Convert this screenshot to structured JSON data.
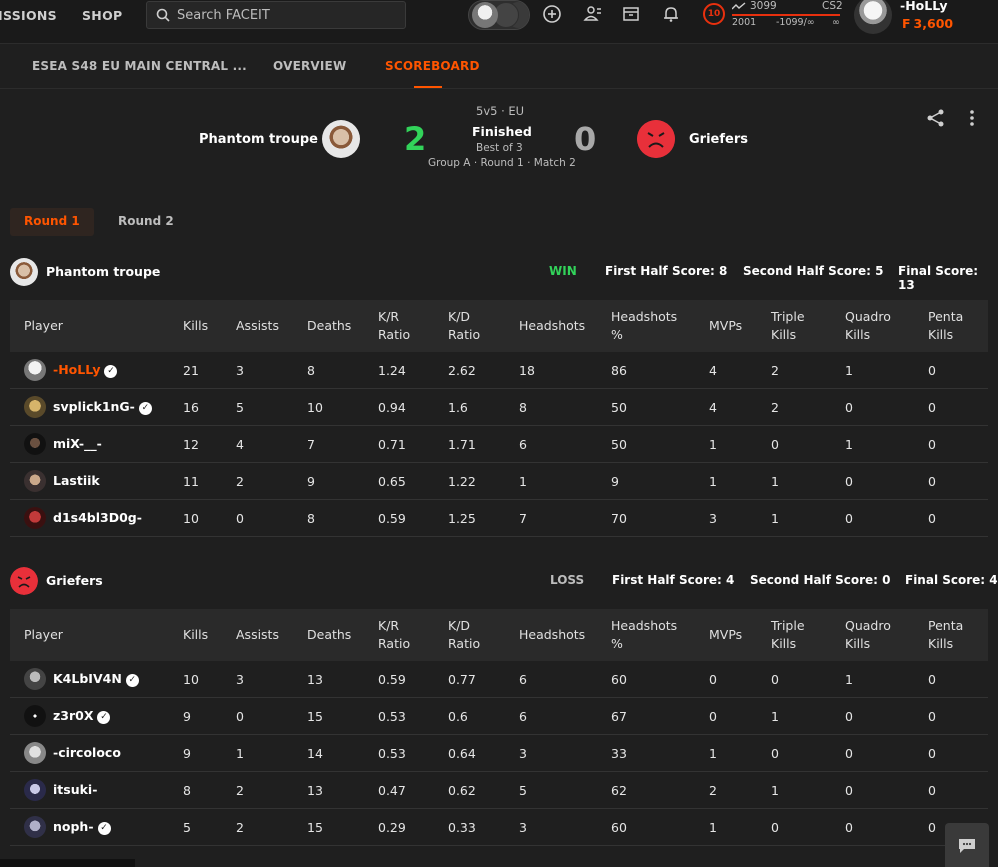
{
  "topbar": {
    "nav_missions": "ISSIONS",
    "nav_shop": "SHOP",
    "search_placeholder": "Search FACEIT",
    "elo": "3099",
    "game": "CS2",
    "elo_min": "2001",
    "elo_range": "-1099/∞",
    "elo_max": "∞",
    "skill_level": "10",
    "username": "-HoLLy",
    "points": "3,600",
    "points_glyph": "F"
  },
  "tabs": {
    "event": "ESEA S48 EU MAIN CENTRAL ...",
    "overview": "OVERVIEW",
    "scoreboard": "SCOREBOARD"
  },
  "match": {
    "team1_name": "Phantom troupe",
    "team1_score": "2",
    "team2_name": "Griefers",
    "team2_score": "0",
    "mode": "5v5 · EU",
    "status": "Finished",
    "best_of": "Best of 3",
    "group": "Group A · Round 1 · Match 2"
  },
  "rounds": [
    "Round 1",
    "Round 2"
  ],
  "columns": {
    "player": "Player",
    "kills": "Kills",
    "assists": "Assists",
    "deaths": "Deaths",
    "kr1": "K/R",
    "kr2": "Ratio",
    "kd1": "K/D",
    "kd2": "Ratio",
    "headshots": "Headshots",
    "hsp1": "Headshots",
    "hsp2": "%",
    "mvps": "MVPs",
    "triple1": "Triple",
    "triple2": "Kills",
    "quadro1": "Quadro",
    "quadro2": "Kills",
    "penta1": "Penta",
    "penta2": "Kills"
  },
  "team1": {
    "name": "Phantom troupe",
    "result": "WIN",
    "result_color": "#32d35a",
    "first_half": "First Half Score: 8",
    "second_half": "Second Half Score: 5",
    "final": "Final Score: 13",
    "players": [
      {
        "name": "-HoLLy",
        "verified": true,
        "kills": "21",
        "assists": "3",
        "deaths": "8",
        "kr": "1.24",
        "kd": "2.62",
        "hs": "18",
        "hsp": "86",
        "mvps": "4",
        "triple": "2",
        "quadro": "1",
        "penta": "0"
      },
      {
        "name": "svplick1nG-",
        "verified": true,
        "kills": "16",
        "assists": "5",
        "deaths": "10",
        "kr": "0.94",
        "kd": "1.6",
        "hs": "8",
        "hsp": "50",
        "mvps": "4",
        "triple": "2",
        "quadro": "0",
        "penta": "0"
      },
      {
        "name": "miX-__-",
        "verified": false,
        "kills": "12",
        "assists": "4",
        "deaths": "7",
        "kr": "0.71",
        "kd": "1.71",
        "hs": "6",
        "hsp": "50",
        "mvps": "1",
        "triple": "0",
        "quadro": "1",
        "penta": "0"
      },
      {
        "name": "Lastiik",
        "verified": false,
        "kills": "11",
        "assists": "2",
        "deaths": "9",
        "kr": "0.65",
        "kd": "1.22",
        "hs": "1",
        "hsp": "9",
        "mvps": "1",
        "triple": "1",
        "quadro": "0",
        "penta": "0"
      },
      {
        "name": "d1s4bl3D0g-",
        "verified": false,
        "kills": "10",
        "assists": "0",
        "deaths": "8",
        "kr": "0.59",
        "kd": "1.25",
        "hs": "7",
        "hsp": "70",
        "mvps": "3",
        "triple": "1",
        "quadro": "0",
        "penta": "0"
      }
    ]
  },
  "team2": {
    "name": "Griefers",
    "result": "LOSS",
    "result_color": "#bdbdbd",
    "first_half": "First Half Score: 4",
    "second_half": "Second Half Score: 0",
    "final": "Final Score: 4",
    "players": [
      {
        "name": "K4LbIV4N",
        "verified": true,
        "kills": "10",
        "assists": "3",
        "deaths": "13",
        "kr": "0.59",
        "kd": "0.77",
        "hs": "6",
        "hsp": "60",
        "mvps": "0",
        "triple": "0",
        "quadro": "1",
        "penta": "0"
      },
      {
        "name": "z3r0X",
        "verified": true,
        "kills": "9",
        "assists": "0",
        "deaths": "15",
        "kr": "0.53",
        "kd": "0.6",
        "hs": "6",
        "hsp": "67",
        "mvps": "0",
        "triple": "1",
        "quadro": "0",
        "penta": "0"
      },
      {
        "name": "-circoloco",
        "verified": false,
        "kills": "9",
        "assists": "1",
        "deaths": "14",
        "kr": "0.53",
        "kd": "0.64",
        "hs": "3",
        "hsp": "33",
        "mvps": "1",
        "triple": "0",
        "quadro": "0",
        "penta": "0"
      },
      {
        "name": "itsuki-",
        "verified": false,
        "kills": "8",
        "assists": "2",
        "deaths": "13",
        "kr": "0.47",
        "kd": "0.62",
        "hs": "5",
        "hsp": "62",
        "mvps": "2",
        "triple": "1",
        "quadro": "0",
        "penta": "0"
      },
      {
        "name": "noph-",
        "verified": true,
        "kills": "5",
        "assists": "2",
        "deaths": "15",
        "kr": "0.29",
        "kd": "0.33",
        "hs": "3",
        "hsp": "60",
        "mvps": "1",
        "triple": "0",
        "quadro": "0",
        "penta": "0"
      }
    ]
  },
  "colors": {
    "accent": "#ff5500",
    "win": "#32d35a",
    "background": "#1f1f1f"
  },
  "icons": [
    "search-icon",
    "plus-circle-icon",
    "friends-icon",
    "store-icon",
    "bell-icon",
    "share-icon",
    "more-vertical-icon",
    "chat-icon",
    "verified-icon"
  ]
}
